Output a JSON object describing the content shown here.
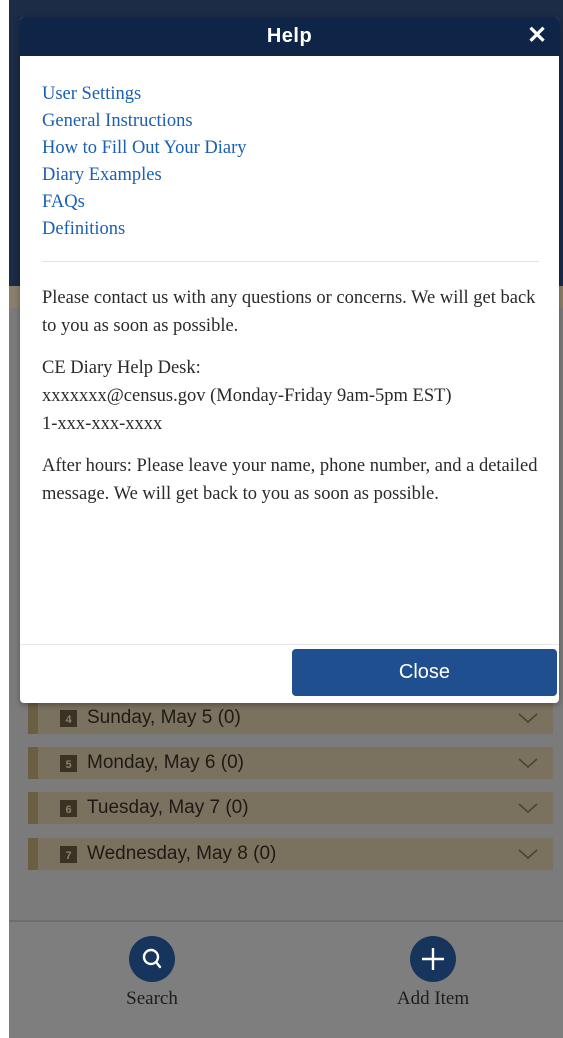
{
  "modal": {
    "title": "Help",
    "close_icon": "close-icon",
    "links": [
      "User Settings",
      "General Instructions",
      "How to Fill Out Your Diary",
      "Diary Examples",
      "FAQs",
      "Definitions"
    ],
    "contact_intro": "Please contact us with any questions or concerns. We will get back to you as soon as possible.",
    "help_desk_title": "CE Diary Help Desk:",
    "help_desk_email": "xxxxxxx@census.gov (Monday-Friday 9am-5pm EST)",
    "help_desk_phone": "1-xxx-xxx-xxxx",
    "after_hours": "After hours: Please leave your name, phone number, and a detailed message. We will get back to you as soon as possible.",
    "close_button": "Close"
  },
  "days": [
    {
      "cal_num": "4",
      "label": "Sunday, May 5 (0)"
    },
    {
      "cal_num": "5",
      "label": "Monday, May 6 (0)"
    },
    {
      "cal_num": "6",
      "label": "Tuesday, May 7 (0)"
    },
    {
      "cal_num": "7",
      "label": "Wednesday, May 8 (0)"
    }
  ],
  "bottom_nav": {
    "search_label": "Search",
    "search_icon": "search-icon",
    "add_label": "Add Item",
    "add_icon": "plus-icon"
  },
  "colors": {
    "header_navy": "#0f2547",
    "link_blue": "#1a5fb4",
    "button_blue": "#1f4f8f"
  }
}
